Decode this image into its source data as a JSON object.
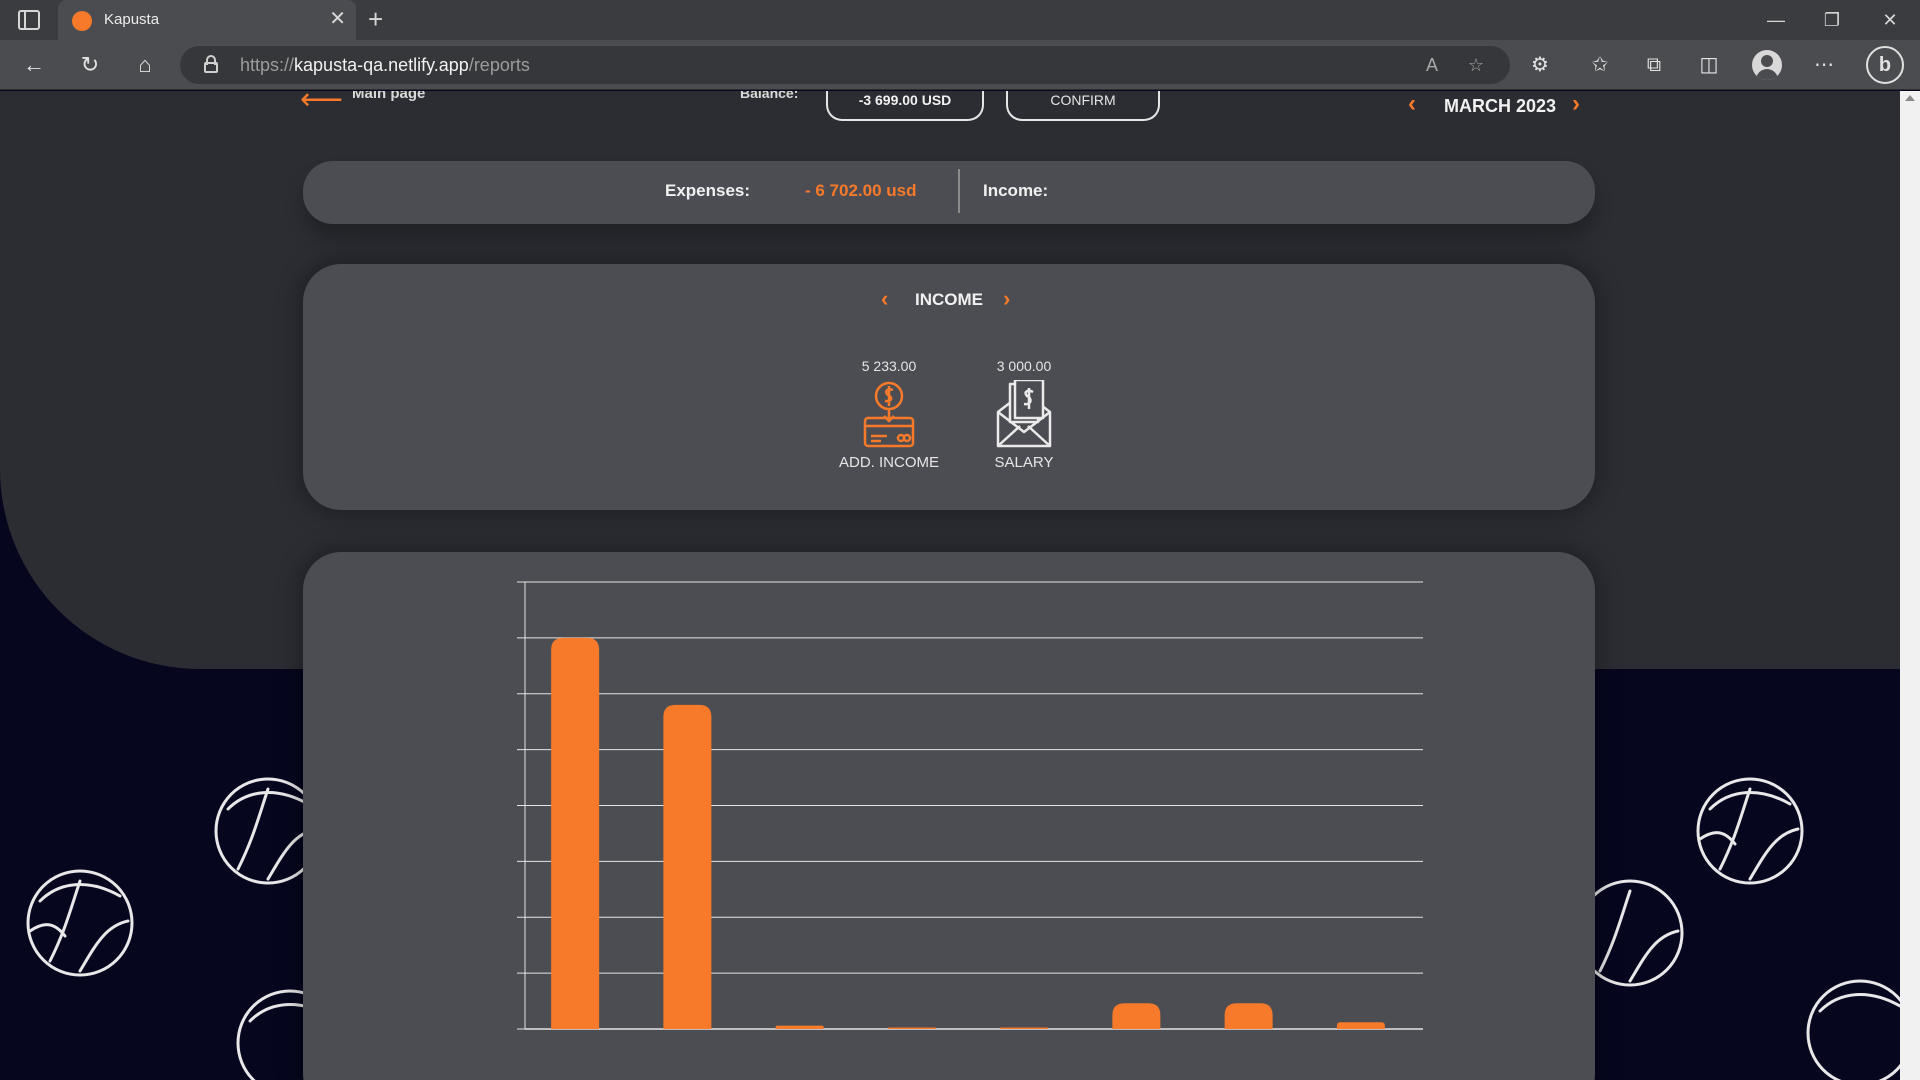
{
  "browser": {
    "tab_title": "Kapusta",
    "url_scheme": "https://",
    "url_host": "kapusta-qa.netlify.app",
    "url_path": "/reports",
    "favicon_color": "#f7792a"
  },
  "header": {
    "main_page_label": "Main page",
    "balance_label": "Balance:",
    "balance_value": "-3 699.00 USD",
    "confirm_label": "CONFIRM",
    "month_label": "MARCH 2023"
  },
  "summary": {
    "expenses_label": "Expenses:",
    "expenses_value": "- 6 702.00  usd",
    "income_label": "Income:"
  },
  "categories": {
    "title": "INCOME",
    "items": [
      {
        "amount": "5 233.00",
        "label": "ADD. INCOME",
        "icon": "add-income-icon",
        "active": true
      },
      {
        "amount": "3 000.00",
        "label": "SALARY",
        "icon": "salary-icon",
        "active": false
      }
    ]
  },
  "colors": {
    "accent": "#f7792a",
    "card": "#4c4d52",
    "hero": "#2c2d33",
    "background": "#06061f"
  },
  "chart_data": {
    "type": "bar",
    "grid": true,
    "ylim": [
      0,
      8
    ],
    "values": [
      7,
      5.8,
      0.06,
      0.02,
      0.02,
      0.46,
      0.46,
      0.12
    ]
  }
}
